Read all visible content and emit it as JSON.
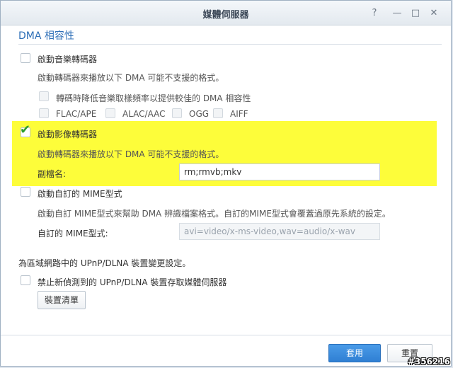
{
  "window": {
    "title": "媒體伺服器",
    "controls": {
      "help": "?",
      "minimize": "—",
      "maximize": "□",
      "close": "✕"
    }
  },
  "section": {
    "title": "DMA 相容性"
  },
  "music_transcoder": {
    "enable_label": "啟動音樂轉碼器",
    "desc": "啟動轉碼器來播放以下 DMA 可能不支援的格式。",
    "downsample_label": "轉碼時降低音樂取樣頻率以提供較佳的 DMA 相容性",
    "formats": [
      "FLAC/APE",
      "ALAC/AAC",
      "OGG",
      "AIFF"
    ]
  },
  "video_transcoder": {
    "enable_label": "啟動影像轉碼器",
    "checked": true,
    "desc": "啟動轉碼器來播放以下 DMA 可能不支援的格式。",
    "ext_label": "副檔名:",
    "ext_value": "rm;rmvb;mkv"
  },
  "custom_mime": {
    "enable_label": "啟動自訂的 MIME型式",
    "desc": "啟動自訂 MIME型式來幫助 DMA 辨識檔案格式。自訂的MIME型式會覆蓋過原先系統的設定。",
    "field_label": "自訂的 MIME型式:",
    "placeholder": "avi=video/x-ms-video,wav=audio/x-wav"
  },
  "upnp": {
    "intro": "為區域網路中的 UPnP/DLNA 裝置變更設定。",
    "block_label": "禁止新偵測到的 UPnP/DLNA 裝置存取媒體伺服器",
    "device_list_button": "裝置清單"
  },
  "footer": {
    "apply": "套用",
    "reset": "重置"
  },
  "watermark": "#356216",
  "colors": {
    "accent": "#2e6fb7",
    "highlight": "#fdfd3a",
    "check": "#2e9d2e",
    "primary_button": "#3a8ddf"
  }
}
